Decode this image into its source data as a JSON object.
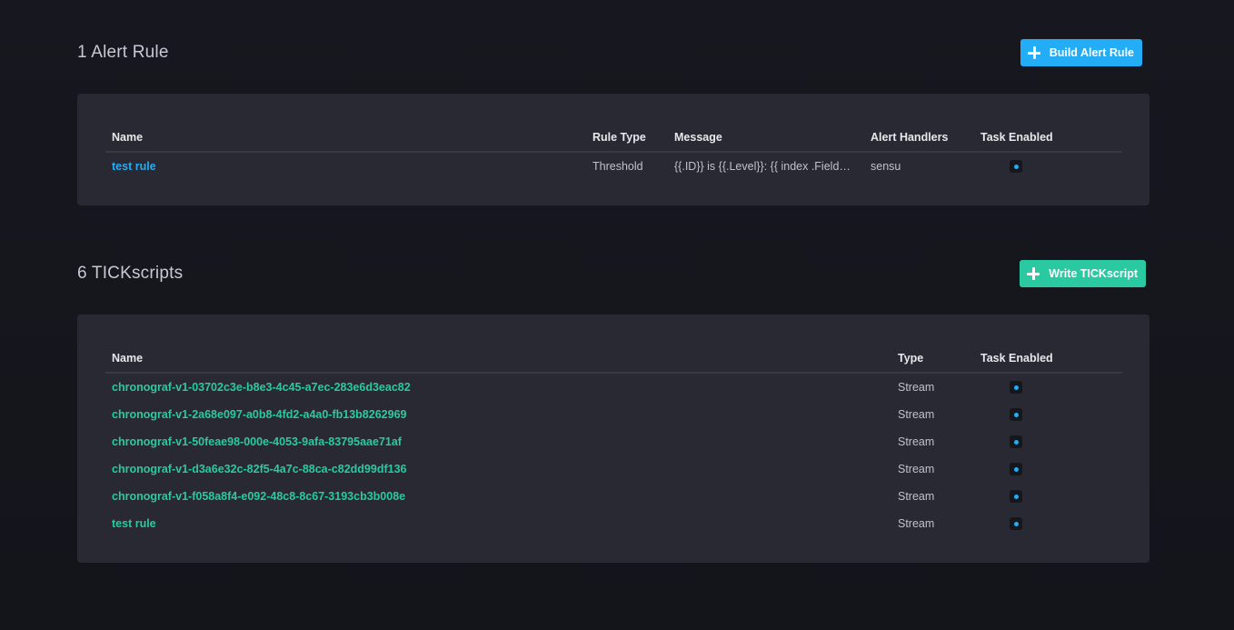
{
  "alert_rules": {
    "title": "1 Alert Rule",
    "button_label": "Build Alert Rule",
    "columns": {
      "name": "Name",
      "rule_type": "Rule Type",
      "message": "Message",
      "alert_handlers": "Alert Handlers",
      "task_enabled": "Task Enabled"
    },
    "rows": [
      {
        "name": "test rule",
        "rule_type": "Threshold",
        "message": "{{.ID}} is {{.Level}}: {{ index .Fields \"value\" }}",
        "alert_handlers": "sensu",
        "enabled": true
      }
    ]
  },
  "tickscripts": {
    "title": "6 TICKscripts",
    "button_label": "Write TICKscript",
    "columns": {
      "name": "Name",
      "type": "Type",
      "task_enabled": "Task Enabled"
    },
    "rows": [
      {
        "name": "chronograf-v1-03702c3e-b8e3-4c45-a7ec-283e6d3eac82",
        "type": "Stream",
        "enabled": true
      },
      {
        "name": "chronograf-v1-2a68e097-a0b8-4fd2-a4a0-fb13b8262969",
        "type": "Stream",
        "enabled": true
      },
      {
        "name": "chronograf-v1-50feae98-000e-4053-9afa-83795aae71af",
        "type": "Stream",
        "enabled": true
      },
      {
        "name": "chronograf-v1-d3a6e32c-82f5-4a7c-88ca-c82dd99df136",
        "type": "Stream",
        "enabled": true
      },
      {
        "name": "chronograf-v1-f058a8f4-e092-48c8-8c67-3193cb3b008e",
        "type": "Stream",
        "enabled": true
      },
      {
        "name": "test rule",
        "type": "Stream",
        "enabled": true
      }
    ]
  },
  "colors": {
    "background": "#17171f",
    "panel": "#292933",
    "accent_blue": "#22adf6",
    "accent_green": "#2ac9a1"
  },
  "icons": {
    "add": "plus-icon"
  }
}
